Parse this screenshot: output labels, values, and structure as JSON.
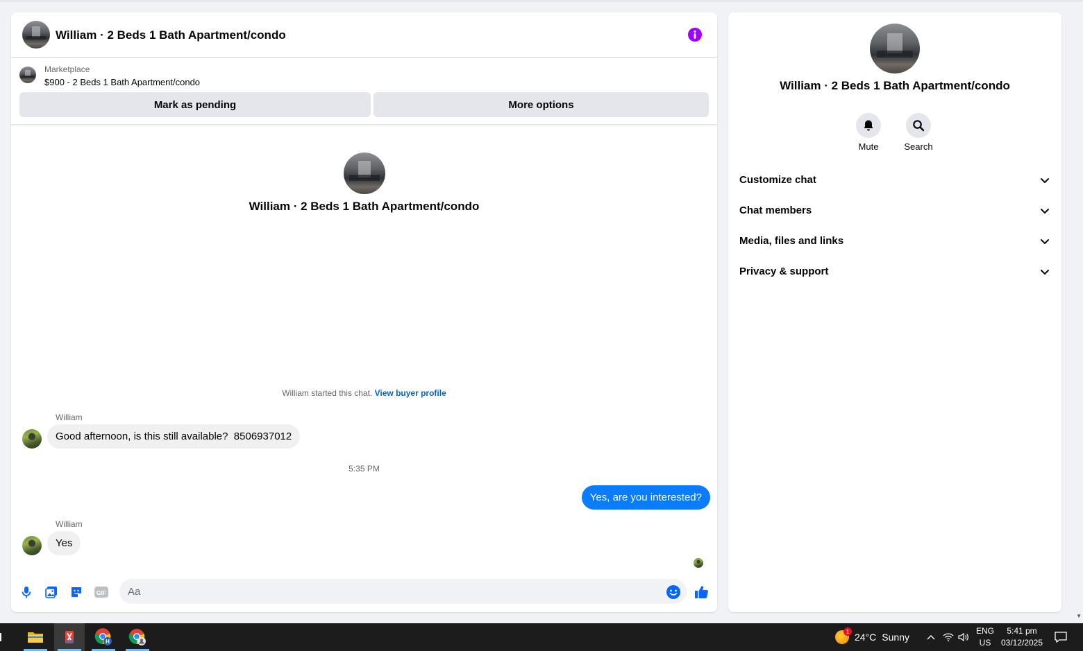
{
  "conversation": {
    "title": "William · 2 Beds 1 Bath Apartment/condo"
  },
  "marketplace": {
    "label": "Marketplace",
    "listing": "$900 - 2 Beds 1 Bath Apartment/condo",
    "mark_pending_label": "Mark as pending",
    "more_options_label": "More options"
  },
  "thread": {
    "intro_name": "William · 2 Beds 1 Bath Apartment/condo",
    "started_text": "William started this chat.",
    "view_profile_link": "View buyer profile",
    "messages": [
      {
        "sender": "William",
        "text": "Good afternoon, is this still available?  8506937012",
        "direction": "incoming"
      },
      {
        "timestamp": "5:35 PM"
      },
      {
        "text": "Yes, are you interested?",
        "direction": "outgoing"
      },
      {
        "sender": "William",
        "text": "Yes",
        "direction": "incoming"
      }
    ]
  },
  "composer": {
    "placeholder": "Aa",
    "icons": [
      "microphone-icon",
      "photo-icon",
      "sticker-icon",
      "gif-icon",
      "emoji-icon",
      "like-icon"
    ],
    "gif_label": "GIF"
  },
  "sidebar": {
    "title": "William · 2 Beds 1 Bath Apartment/condo",
    "actions": [
      {
        "label": "Mute",
        "icon": "bell-icon"
      },
      {
        "label": "Search",
        "icon": "search-icon"
      }
    ],
    "sections": [
      {
        "label": "Customize chat"
      },
      {
        "label": "Chat members"
      },
      {
        "label": "Media, files and links"
      },
      {
        "label": "Privacy & support"
      }
    ]
  },
  "taskbar": {
    "weather_temp": "24°C",
    "weather_desc": "Sunny",
    "weather_badge": "1",
    "lang_top": "ENG",
    "lang_bottom": "US",
    "time": "5:41 pm",
    "date": "03/12/2025"
  },
  "colors": {
    "accent": "#0a7cff",
    "info": "#a100ff",
    "link": "#0064d1",
    "composer_icon": "#0866ff"
  }
}
